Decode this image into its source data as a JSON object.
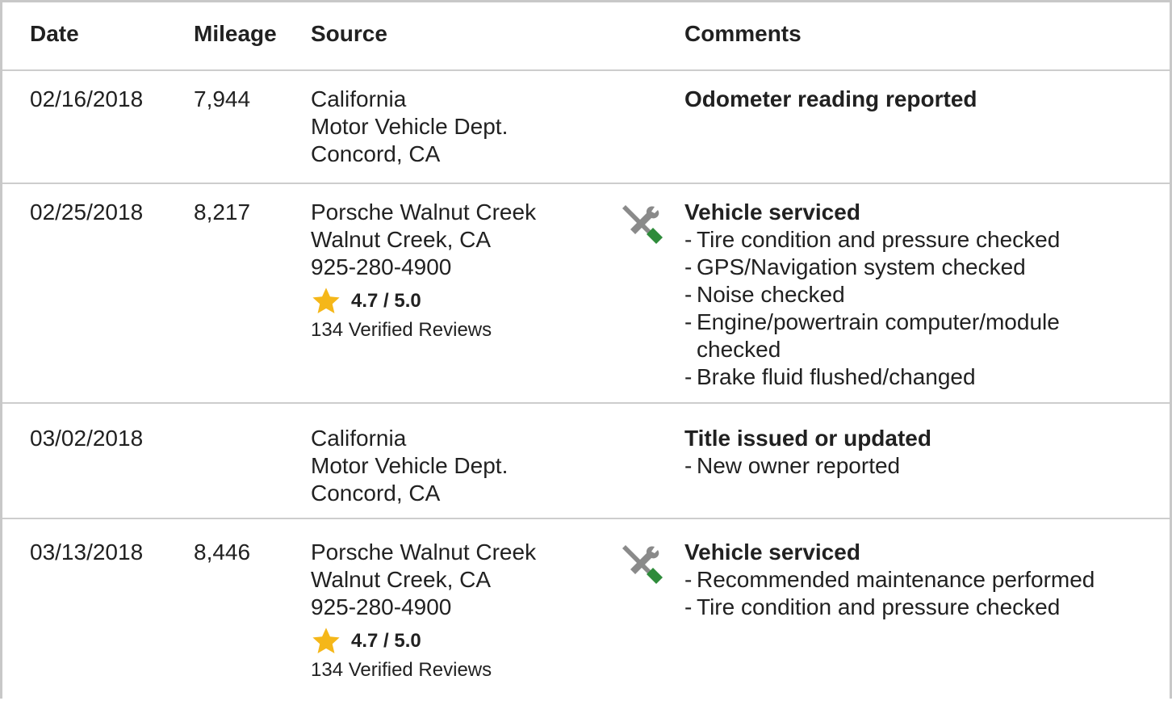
{
  "headers": {
    "date": "Date",
    "mileage": "Mileage",
    "source": "Source",
    "comments": "Comments"
  },
  "colors": {
    "star": "#f5b719",
    "wrench_gray": "#8a8a8a",
    "screwdriver_green": "#2e8b3a",
    "border": "#cdcdcd"
  },
  "rows": [
    {
      "date": "02/16/2018",
      "mileage": "7,944",
      "source": [
        "California",
        "Motor Vehicle Dept.",
        "Concord, CA"
      ],
      "comment_title": "Odometer reading reported",
      "items": []
    },
    {
      "date": "02/25/2018",
      "mileage": "8,217",
      "source": [
        "Porsche Walnut Creek",
        "Walnut Creek, CA",
        "925-280-4900"
      ],
      "rating": "4.7 / 5.0",
      "reviews": "134 Verified Reviews",
      "icon": "service-tools-icon",
      "comment_title": "Vehicle serviced",
      "items": [
        "Tire condition and pressure checked",
        "GPS/Navigation system checked",
        "Noise checked",
        "Engine/powertrain computer/module checked",
        "Brake fluid flushed/changed"
      ]
    },
    {
      "date": "03/02/2018",
      "mileage": "",
      "source": [
        "California",
        "Motor Vehicle Dept.",
        "Concord, CA"
      ],
      "comment_title": "Title issued or updated",
      "items": [
        "New owner reported"
      ]
    },
    {
      "date": "03/13/2018",
      "mileage": "8,446",
      "source": [
        "Porsche Walnut Creek",
        "Walnut Creek, CA",
        "925-280-4900"
      ],
      "rating": "4.7 / 5.0",
      "reviews": "134 Verified Reviews",
      "icon": "service-tools-icon",
      "comment_title": "Vehicle serviced",
      "items": [
        "Recommended maintenance performed",
        "Tire condition and pressure checked"
      ]
    }
  ]
}
